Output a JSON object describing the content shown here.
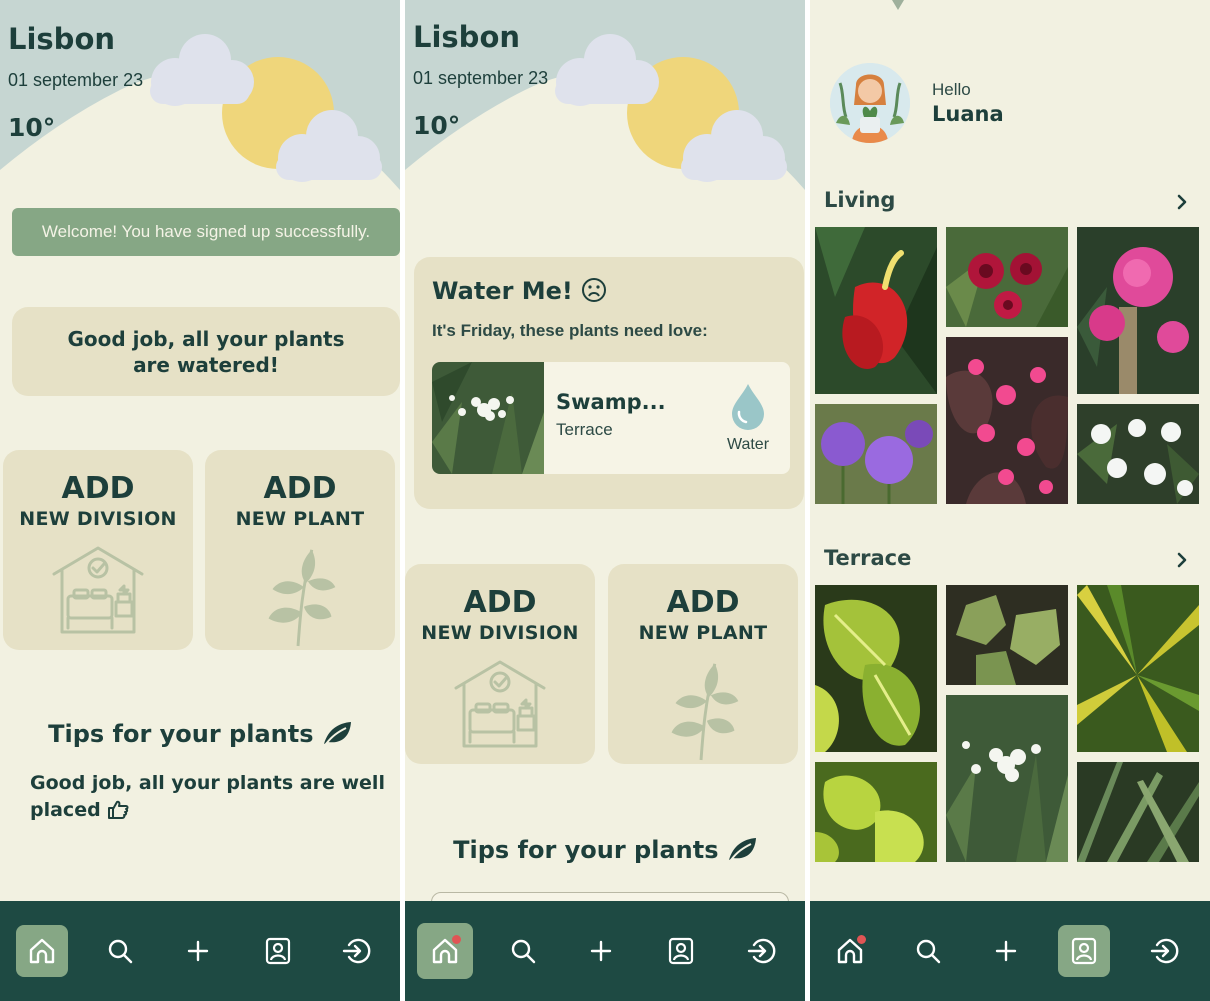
{
  "weather": {
    "city": "Lisbon",
    "date": "01 september 23",
    "temperature": "10°"
  },
  "screen1": {
    "toast": "Welcome! You have signed up successfully.",
    "watered_message": "Good job, all your plants are watered!",
    "add_division": {
      "title": "ADD",
      "subtitle": "NEW DIVISION"
    },
    "add_plant": {
      "title": "ADD",
      "subtitle": "NEW PLANT"
    },
    "tips_title": "Tips for your plants",
    "tips_message": "Good job, all your plants are well placed"
  },
  "screen2": {
    "water_title": "Water Me!",
    "water_subtitle": "It's Friday, these plants need love:",
    "plant": {
      "name": "Swamp...",
      "location": "Terrace",
      "action": "Water"
    },
    "add_division": {
      "title": "ADD",
      "subtitle": "NEW DIVISION"
    },
    "add_plant": {
      "title": "ADD",
      "subtitle": "NEW PLANT"
    },
    "tips_title": "Tips for your plants"
  },
  "screen3": {
    "greeting": "Hello",
    "user_name": "Luana",
    "sections": [
      {
        "title": "Living"
      },
      {
        "title": "Terrace"
      }
    ]
  },
  "nav": {
    "items": [
      "home-icon",
      "search-icon",
      "plus-icon",
      "profile-icon",
      "logout-icon"
    ]
  },
  "colors": {
    "background": "#f2f1e1",
    "card": "#e6e1c6",
    "nav_bar": "#1e4a43",
    "accent": "#86a785",
    "text_dark": "#1d3f3b",
    "notification_dot": "#e05555"
  }
}
